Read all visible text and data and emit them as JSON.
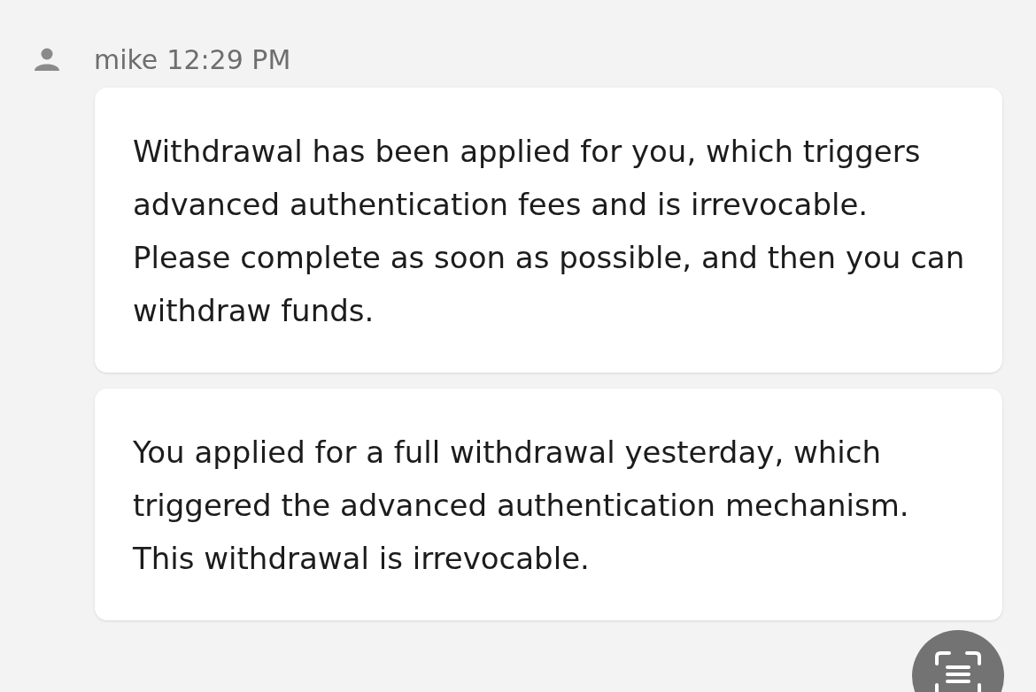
{
  "message_group": {
    "sender": "mike",
    "time": "12:29 PM",
    "messages": [
      {
        "text": "Withdrawal has been applied for you, which triggers advanced authentication fees and is irrevocable. Please complete as soon as possible, and then you can withdraw funds."
      },
      {
        "text": "You applied for a full withdrawal yesterday, which triggered the advanced authentication mechanism. This withdrawal is irrevocable."
      }
    ]
  }
}
